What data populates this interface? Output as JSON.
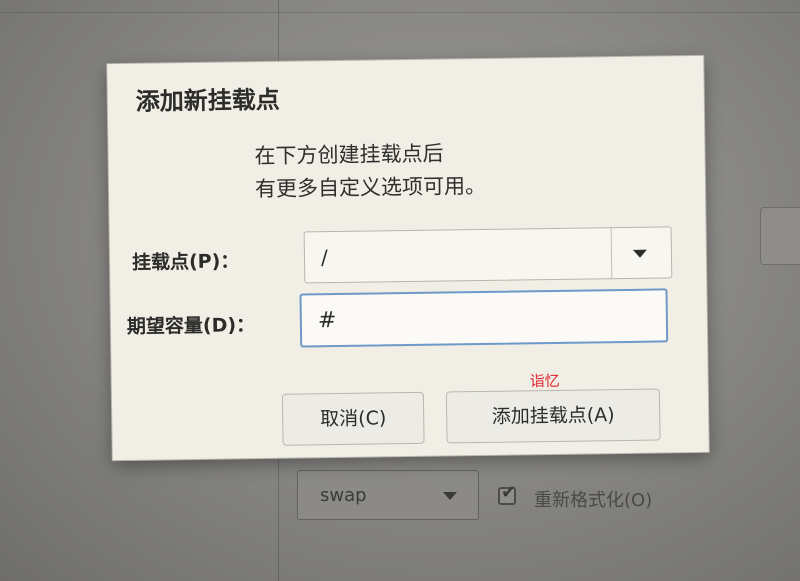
{
  "background": {
    "combo_value": "swap",
    "reformat_checkbox": {
      "label": "重新格式化(O)",
      "checked": true
    }
  },
  "dialog": {
    "title": "添加新挂载点",
    "description_line1": "在下方创建挂载点后",
    "description_line2": "有更多自定义选项可用。",
    "mount_point": {
      "label": "挂载点(P)：",
      "value": "/"
    },
    "desired_capacity": {
      "label": "期望容量(D)：",
      "value": "#"
    },
    "buttons": {
      "cancel": "取消(C)",
      "add": "添加挂载点(A)"
    }
  },
  "watermark": "诣忆",
  "colors": {
    "dialog_bg": "#f1eee6",
    "focus_border": "#6f99c8",
    "watermark": "#e0202a"
  }
}
